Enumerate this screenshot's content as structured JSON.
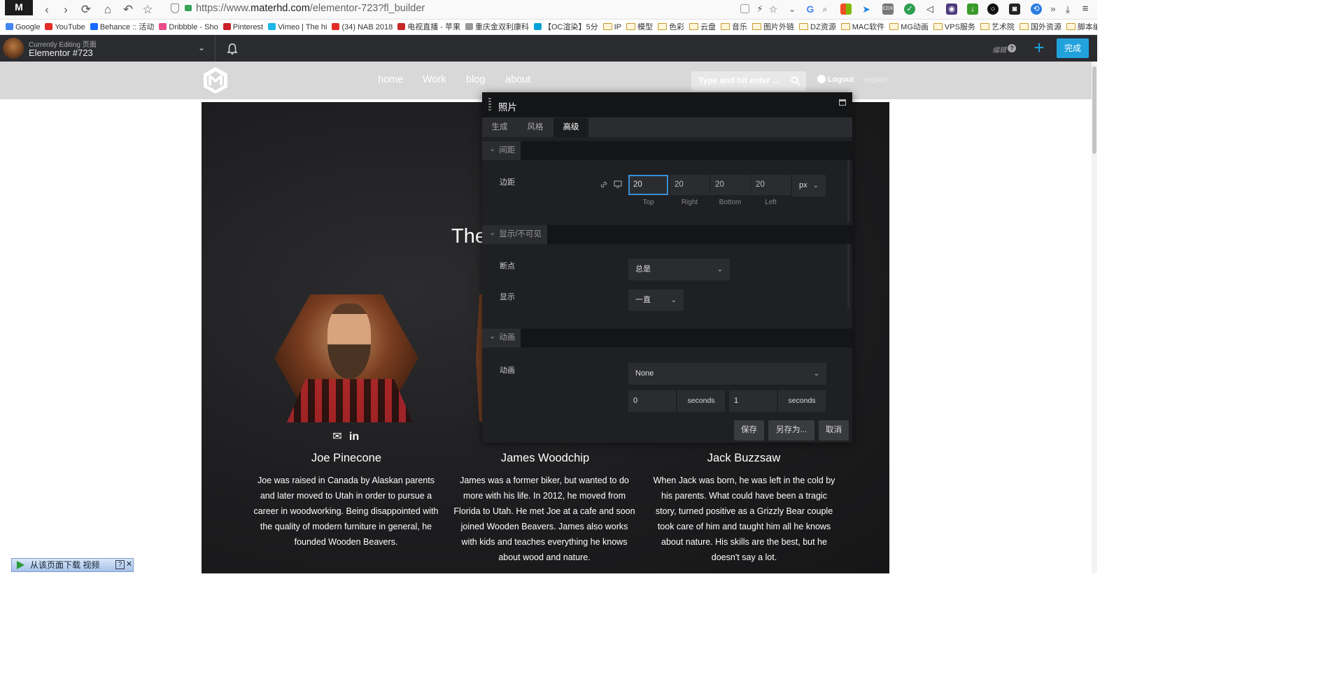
{
  "browser": {
    "url_prefix": "https://www.",
    "url_domain": "materhd.com",
    "url_path": "/elementor-723?fl_builder",
    "logo_glyph": "M"
  },
  "bookmarks": [
    {
      "label": "Google",
      "color": "#4285f4"
    },
    {
      "label": "YouTube",
      "color": "#e52d27"
    },
    {
      "label": "Behance :: 活动",
      "color": "#1769ff"
    },
    {
      "label": "Dribbble - Sho",
      "color": "#ea4c89"
    },
    {
      "label": "Pinterest",
      "color": "#cb2027"
    },
    {
      "label": "Vimeo | The hi",
      "color": "#1ab7ea"
    },
    {
      "label": "(34) NAB 2018",
      "color": "#e52d27"
    },
    {
      "label": "电视直播 - 苹果",
      "color": "#c62828"
    },
    {
      "label": "重庆金双利康科",
      "color": "#999999"
    },
    {
      "label": "【OC渲染】5分",
      "color": "#00a1d6"
    },
    {
      "label": "IP",
      "folder": true
    },
    {
      "label": "模型",
      "folder": true
    },
    {
      "label": "色彩",
      "folder": true
    },
    {
      "label": "云盘",
      "folder": true
    },
    {
      "label": "音乐",
      "folder": true
    },
    {
      "label": "图片外链",
      "folder": true
    },
    {
      "label": "DZ资源",
      "folder": true
    },
    {
      "label": "MAC软件",
      "folder": true
    },
    {
      "label": "MG动画",
      "folder": true
    },
    {
      "label": "VPS服务",
      "folder": true
    },
    {
      "label": "艺术院",
      "folder": true
    },
    {
      "label": "国外资源",
      "folder": true
    },
    {
      "label": "脚本编程",
      "folder": true
    }
  ],
  "elementor_bar": {
    "editing_label": "Currently Editing 页面",
    "editing_title": "Elementor #723",
    "status_text": "编辑",
    "help_label": "?",
    "done_label": "完成",
    "add_glyph": "+"
  },
  "site": {
    "nav": [
      "home",
      "Work",
      "blog",
      "about"
    ],
    "search_placeholder": "Type and hit enter ...",
    "logout_label": "Logout",
    "register_label": "register"
  },
  "content": {
    "heading_partial": "The",
    "members": [
      {
        "name": "Joe Pinecone",
        "bio": "Joe was raised in Canada by Alaskan parents and later moved to Utah in order to pursue a career in woodworking. Being disappointed with the quality of modern furniture in general, he founded Wooden Beavers."
      },
      {
        "name": "James Woodchip",
        "bio": "James was a former biker, but wanted to do more with his life. In 2012, he moved from Florida to Utah. He met Joe at a cafe and soon joined Wooden Beavers. James also works with kids and teaches everything he knows about wood and nature."
      },
      {
        "name": "Jack Buzzsaw",
        "bio": "When Jack was born, he was left in the cold by his parents. What could have been a tragic story, turned positive as a Grizzly Bear couple took care of him and taught him all he knows about nature. His skills are the best, but he doesn't say a lot."
      }
    ],
    "social": {
      "email_glyph": "✉",
      "linkedin_glyph": "in"
    }
  },
  "panel": {
    "title": "照片",
    "tabs": [
      "生成",
      "风格",
      "高级"
    ],
    "active_tab": "高级",
    "sections": {
      "spacing": {
        "label": "间距",
        "field_label": "边距",
        "values": {
          "top": "20",
          "right": "20",
          "bottom": "20",
          "left": "20"
        },
        "dim_labels": [
          "Top",
          "Right",
          "Bottom",
          "Left"
        ],
        "unit": "px"
      },
      "visibility": {
        "label": "显示/不可见",
        "breakpoint_label": "断点",
        "breakpoint_value": "总是",
        "display_label": "显示",
        "display_value": "一直"
      },
      "animation": {
        "label": "动画",
        "field_label": "动画",
        "animation_value": "None",
        "delay_value": "0",
        "delay_unit": "seconds",
        "duration_value": "1",
        "duration_unit": "seconds"
      }
    },
    "buttons": {
      "save": "保存",
      "save_as": "另存为...",
      "cancel": "取消"
    }
  },
  "download_widget": {
    "text": "从该页面下载 视频",
    "help": "?",
    "close": "✕"
  },
  "colors": {
    "accent": "#22a2dc",
    "panel_bg": "#1f2023",
    "focus_border": "#3a8fd6"
  }
}
